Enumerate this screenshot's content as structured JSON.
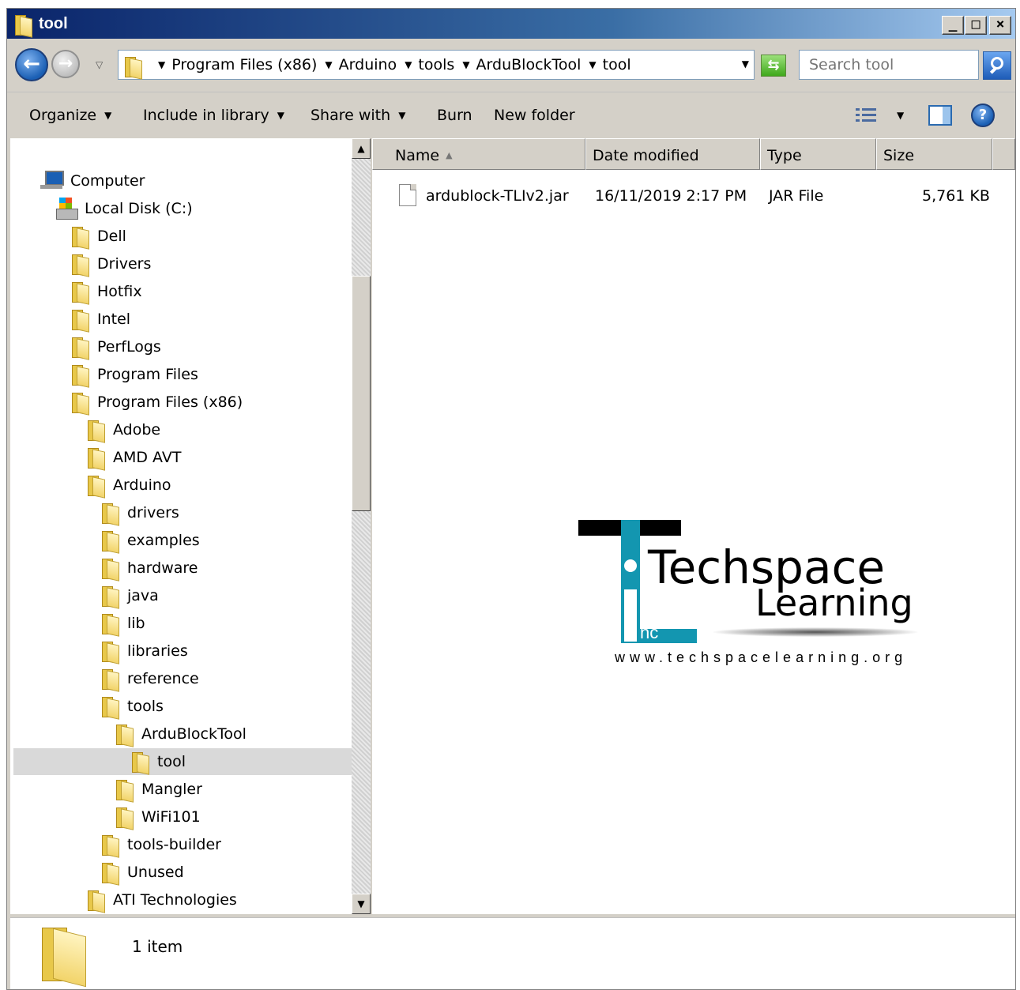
{
  "window": {
    "title": "tool"
  },
  "address": {
    "breadcrumbs": [
      "Program Files (x86)",
      "Arduino",
      "tools",
      "ArduBlockTool",
      "tool"
    ]
  },
  "search": {
    "placeholder": "Search tool"
  },
  "commandbar": {
    "organize": "Organize",
    "include_in_library": "Include in library",
    "share_with": "Share with",
    "burn": "Burn",
    "new_folder": "New folder"
  },
  "tree": {
    "computer": "Computer",
    "local_disk": "Local Disk (C:)",
    "root_folders": [
      "Dell",
      "Drivers",
      "Hotfix",
      "Intel",
      "PerfLogs",
      "Program Files",
      "Program Files (x86)"
    ],
    "x86_folders": [
      "Adobe",
      "AMD AVT",
      "Arduino"
    ],
    "arduino_folders": [
      "drivers",
      "examples",
      "hardware",
      "java",
      "lib",
      "libraries",
      "reference",
      "tools"
    ],
    "tools_folders": [
      "ArduBlockTool"
    ],
    "ardublock_folders": [
      "tool"
    ],
    "tools_folders_after": [
      "Mangler",
      "WiFi101"
    ],
    "arduino_after": [
      "tools-builder",
      "Unused"
    ],
    "x86_after": [
      "ATI Technologies"
    ],
    "selected": "tool"
  },
  "columns": {
    "name": "Name",
    "date_modified": "Date modified",
    "type": "Type",
    "size": "Size"
  },
  "files": [
    {
      "name": "ardublock-TLIv2.jar",
      "date_modified": "16/11/2019 2:17 PM",
      "type": "JAR File",
      "size": "5,761 KB"
    }
  ],
  "watermark": {
    "line1": "Techspace",
    "line2": "Learning",
    "inc": "nc",
    "url": "www.techspacelearning.org"
  },
  "details": {
    "item_count": "1 item"
  },
  "colors": {
    "title_bar": "#0a246a",
    "logo_teal": "#1396b0",
    "selection": "#d9d9d9"
  }
}
